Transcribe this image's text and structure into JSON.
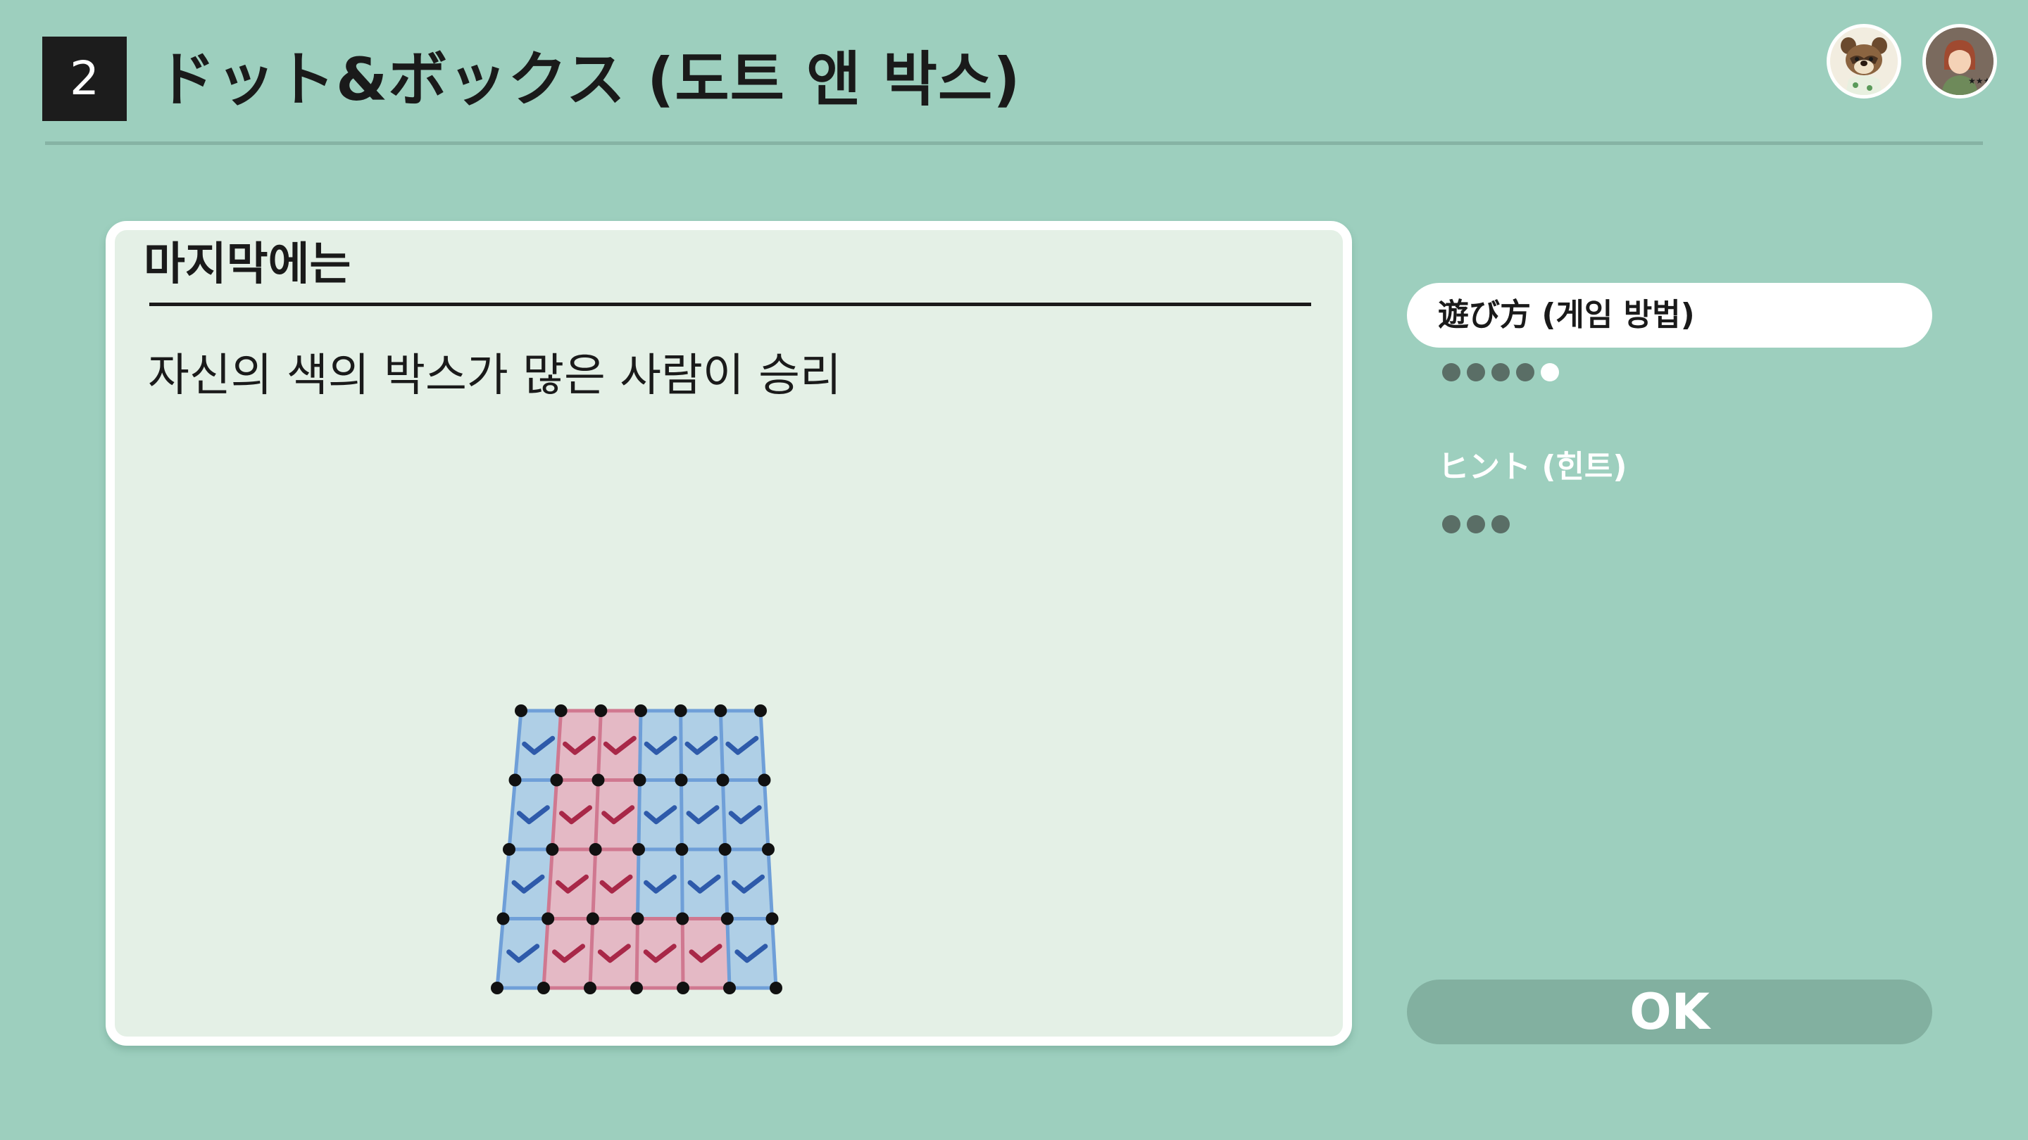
{
  "header": {
    "step_number": "2",
    "title": "ドット&ボックス (도트 앤 박스)"
  },
  "card": {
    "heading": "마지막에는",
    "text": "자신의 색의 박스가 많은 사람이 승리"
  },
  "sections": [
    {
      "label": "遊び方 (게임 방법)",
      "active": true,
      "pages": 5,
      "current_page": 5
    },
    {
      "label": "ヒント (힌트)",
      "active": false,
      "pages": 3,
      "current_page": 0
    }
  ],
  "buttons": {
    "ok_label": "OK"
  },
  "avatars": [
    {
      "icon": "tom-nook-avatar-icon"
    },
    {
      "icon": "player-avatar-icon"
    }
  ],
  "illustration": {
    "rows": 4,
    "cols": 6,
    "owners": [
      [
        "blue",
        "red",
        "red",
        "blue",
        "blue",
        "blue"
      ],
      [
        "blue",
        "red",
        "red",
        "blue",
        "blue",
        "blue"
      ],
      [
        "blue",
        "red",
        "red",
        "blue",
        "blue",
        "blue"
      ],
      [
        "blue",
        "red",
        "red",
        "red",
        "red",
        "blue"
      ]
    ],
    "colors": {
      "blue_fill": "#a9cbe6",
      "blue_mark": "#2e5aaa",
      "blue_line": "#6f9fd8",
      "red_fill": "#e3b3c1",
      "red_mark": "#a82848",
      "red_line": "#d07890",
      "dot": "#111111"
    }
  },
  "colors": {
    "background": "#9dcfbe",
    "card": "#e4f0e6",
    "button": "#82b0a0"
  }
}
